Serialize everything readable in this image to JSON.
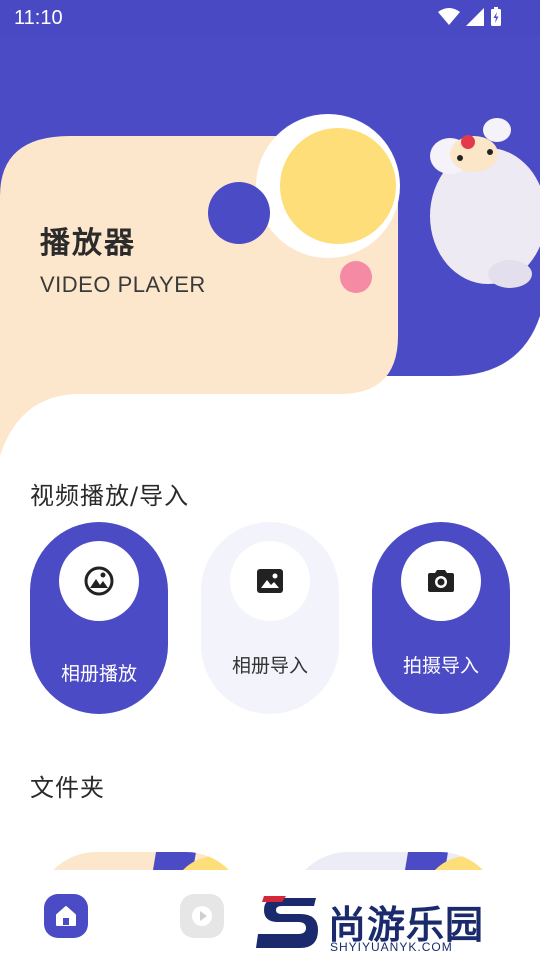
{
  "status_bar": {
    "time": "11:10"
  },
  "hero": {
    "title": "播放器",
    "subtitle": "VIDEO PLAYER"
  },
  "sections": {
    "video": "视频播放/导入",
    "folders": "文件夹"
  },
  "actions": [
    {
      "label": "相册播放",
      "icon": "gallery-icon",
      "style": "primary"
    },
    {
      "label": "相册导入",
      "icon": "image-icon",
      "style": "light"
    },
    {
      "label": "拍摄导入",
      "icon": "camera-icon",
      "style": "primary"
    }
  ],
  "bottom_nav": {
    "items": [
      {
        "icon": "home-icon",
        "active": true
      },
      {
        "icon": "play-icon",
        "active": false
      }
    ]
  },
  "watermark": {
    "text": "尚游乐园",
    "sub": "SHYIYUANYK.COM"
  },
  "colors": {
    "accent": "#4c4bc6",
    "peach": "#fde7cc",
    "yellow": "#fede79",
    "pink": "#f48aa3",
    "light_card": "#f3f3fb"
  }
}
